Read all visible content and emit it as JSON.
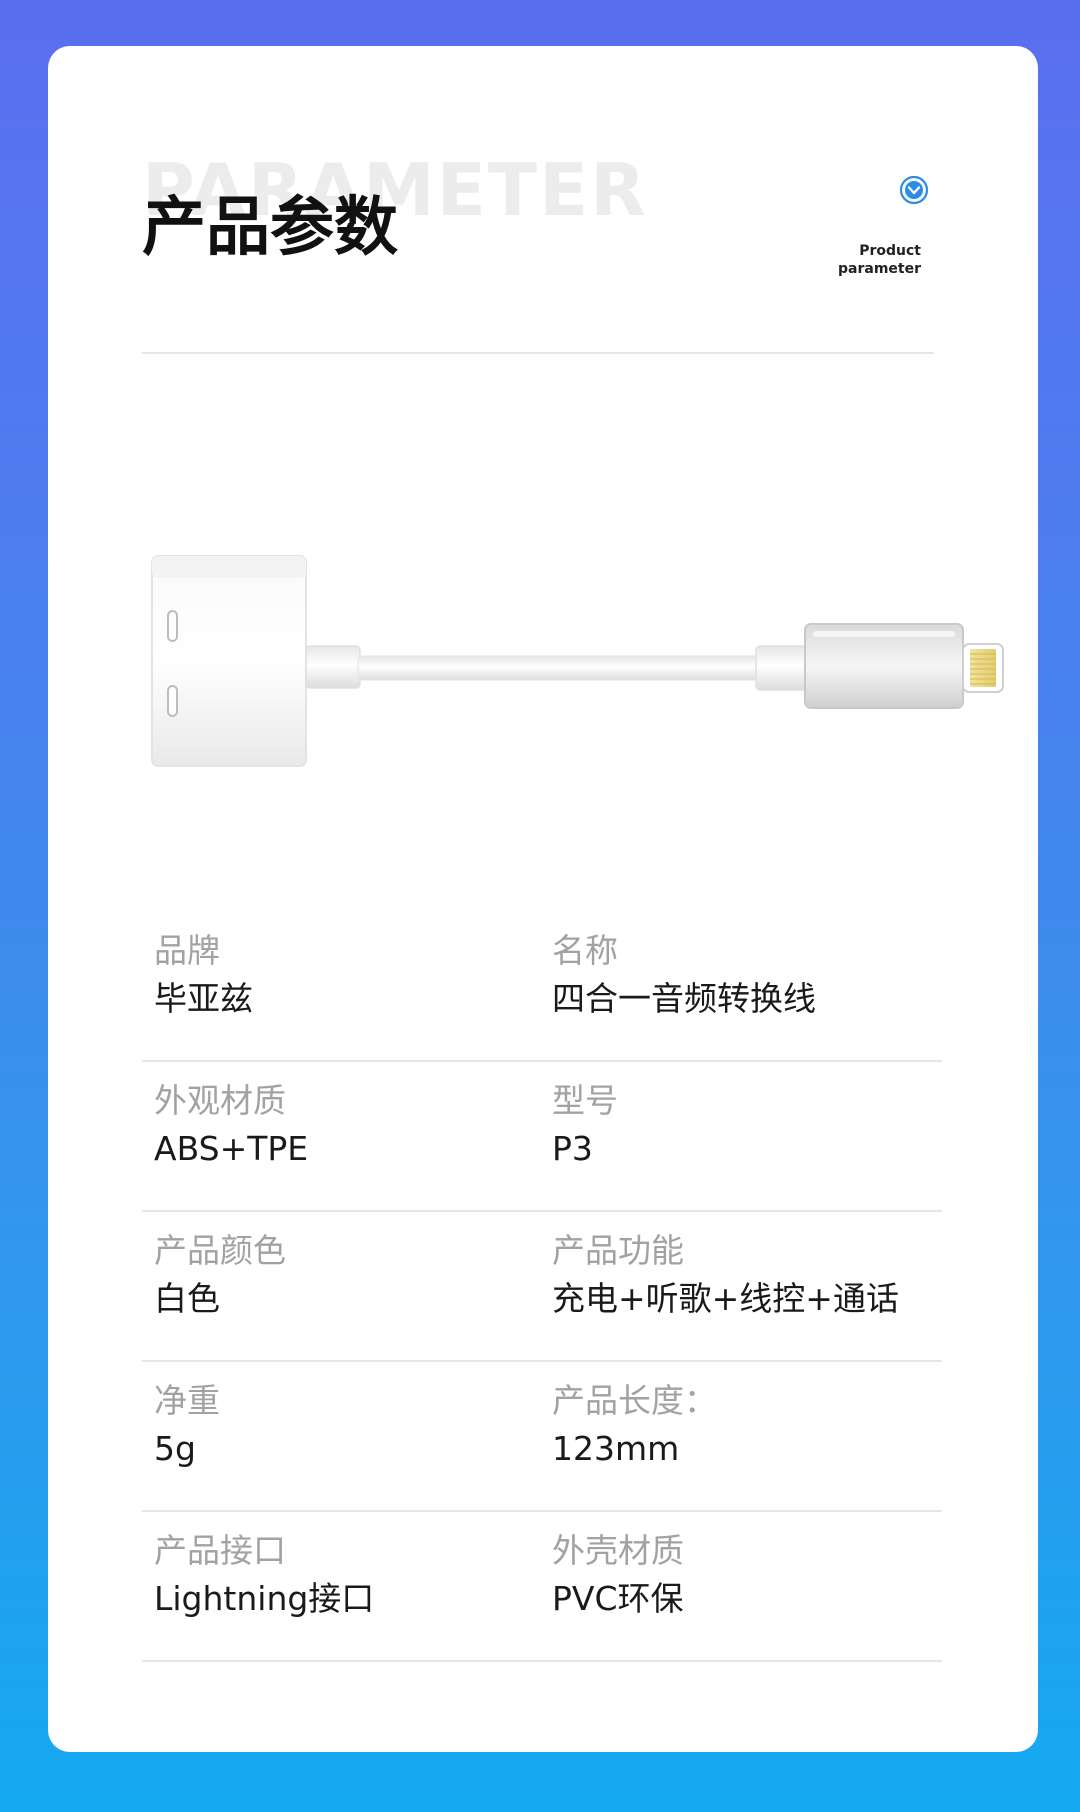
{
  "header": {
    "watermark": "PARAMETER",
    "title": "产品参数",
    "badge_line1": "Product",
    "badge_line2": "parameter",
    "badge_icon": "chevron-down-circle-icon"
  },
  "colors": {
    "background_top": "#5b6ef0",
    "background_bottom": "#14a9f0",
    "card": "#ffffff",
    "accent": "#2b8de8",
    "label": "#a2a2a2",
    "value": "#1a1a1a"
  },
  "product_image": {
    "description_icon": "lightning-splitter-adapter"
  },
  "specs": [
    {
      "left": {
        "label": "品牌",
        "value": "毕亚兹"
      },
      "right": {
        "label": "名称",
        "value": "四合一音频转换线"
      }
    },
    {
      "left": {
        "label": "外观材质",
        "value": "ABS+TPE"
      },
      "right": {
        "label": "型号",
        "value": "P3"
      }
    },
    {
      "left": {
        "label": "产品颜色",
        "value": "白色"
      },
      "right": {
        "label": "产品功能",
        "value": "充电+听歌+线控+通话"
      }
    },
    {
      "left": {
        "label": "净重",
        "value": "5g"
      },
      "right": {
        "label": "产品长度：",
        "value": "123mm"
      }
    },
    {
      "left": {
        "label": "产品接口",
        "value": "Lightning接口"
      },
      "right": {
        "label": "外壳材质",
        "value": "PVC环保"
      }
    }
  ]
}
